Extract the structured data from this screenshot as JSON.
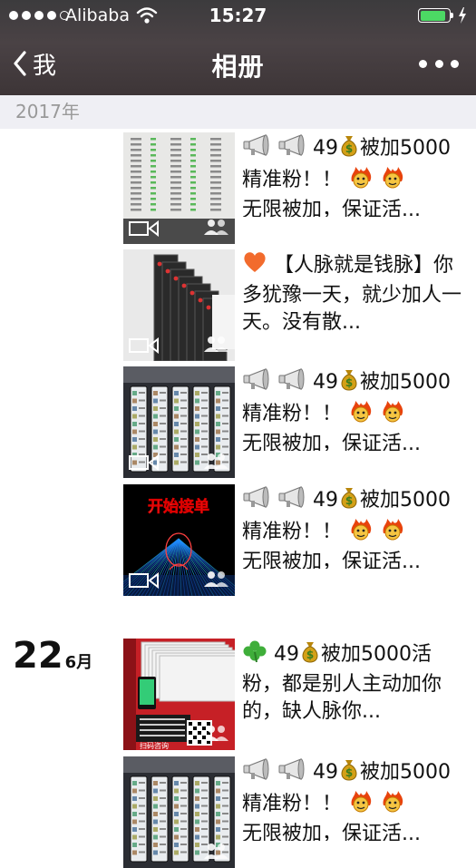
{
  "status_bar": {
    "carrier": "Alibaba",
    "time": "15:27",
    "battery_level": 0.92,
    "signal_bars": 4
  },
  "nav": {
    "back_label": "我",
    "title": "相册",
    "more_icon": "more-dots-icon"
  },
  "year_header": "2017年",
  "day_group": {
    "day": "22",
    "month": "6月"
  },
  "posts": [
    {
      "prefix_icons": [
        "megaphone-icon",
        "megaphone-icon"
      ],
      "text": "49",
      "money_icon": "money-bag-icon",
      "rest": "被加5000精准粉！！",
      "suffix_icons": [
        "fire-face-icon",
        "fire-face-icon"
      ],
      "line3": "无限被加，保证活...",
      "has_video": true,
      "thumb": "screens"
    },
    {
      "prefix_icons": [
        "heart-icon"
      ],
      "text": "【人脉就是钱脉】你多犹豫一天，就少加人一天。没有散...",
      "has_video": true,
      "thumb": "phones"
    },
    {
      "prefix_icons": [
        "megaphone-icon",
        "megaphone-icon"
      ],
      "text": "49",
      "money_icon": "money-bag-icon",
      "rest": "被加5000精准粉！！",
      "suffix_icons": [
        "fire-face-icon",
        "fire-face-icon"
      ],
      "line3": "无限被加，保证活...",
      "has_video": true,
      "thumb": "phones-row"
    },
    {
      "prefix_icons": [
        "megaphone-icon",
        "megaphone-icon"
      ],
      "text": "49",
      "money_icon": "money-bag-icon",
      "rest": "被加5000精准粉！！",
      "suffix_icons": [
        "fire-face-icon",
        "fire-face-icon"
      ],
      "line3": "无限被加，保证活...",
      "has_video": true,
      "thumb": "start",
      "thumb_caption": "开始接单"
    },
    {
      "prefix_icons": [
        "clover-icon"
      ],
      "text": "49",
      "money_icon": "money-bag-icon",
      "rest": "被加5000活粉，都是别人主动加你的，缺人脉你...",
      "has_video": false,
      "thumb": "poster",
      "thumb_caption": "扫码咨询"
    },
    {
      "prefix_icons": [
        "megaphone-icon",
        "megaphone-icon"
      ],
      "text": "49",
      "money_icon": "money-bag-icon",
      "rest": "被加5000精准粉！！",
      "suffix_icons": [
        "fire-face-icon",
        "fire-face-icon"
      ],
      "line3": "无限被加，保证活...",
      "has_video": false,
      "thumb": "phones-row"
    }
  ],
  "colors": {
    "nav_bg": "#413a3c",
    "year_bar_bg": "#efeff4",
    "battery": "#4cd964"
  }
}
